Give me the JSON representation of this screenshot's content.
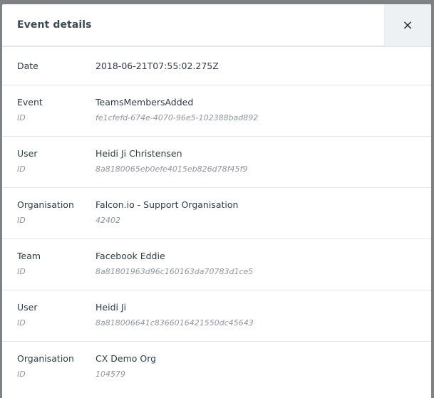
{
  "modal": {
    "title": "Event details",
    "close_label": "×"
  },
  "rows": [
    {
      "label": "Date",
      "value": "2018-06-21T07:55:02.275Z"
    },
    {
      "label": "Event",
      "value": "TeamsMembersAdded",
      "sub_label": "ID",
      "sub_value": "fe1cfefd-674e-4070-96e5-102388bad892"
    },
    {
      "label": "User",
      "value": "Heidi Ji Christensen",
      "sub_label": "ID",
      "sub_value": "8a8180065eb0efe4015eb826d78f45f9"
    },
    {
      "label": "Organisation",
      "value": "Falcon.io - Support Organisation",
      "sub_label": "ID",
      "sub_value": "42402"
    },
    {
      "label": "Team",
      "value": "Facebook Eddie",
      "sub_label": "ID",
      "sub_value": "8a81801963d96c160163da70783d1ce5"
    },
    {
      "label": "User",
      "value": "Heidi Ji",
      "sub_label": "ID",
      "sub_value": "8a818006641c8366016421550dc45643"
    },
    {
      "label": "Organisation",
      "value": "CX Demo Org",
      "sub_label": "ID",
      "sub_value": "104579"
    }
  ]
}
